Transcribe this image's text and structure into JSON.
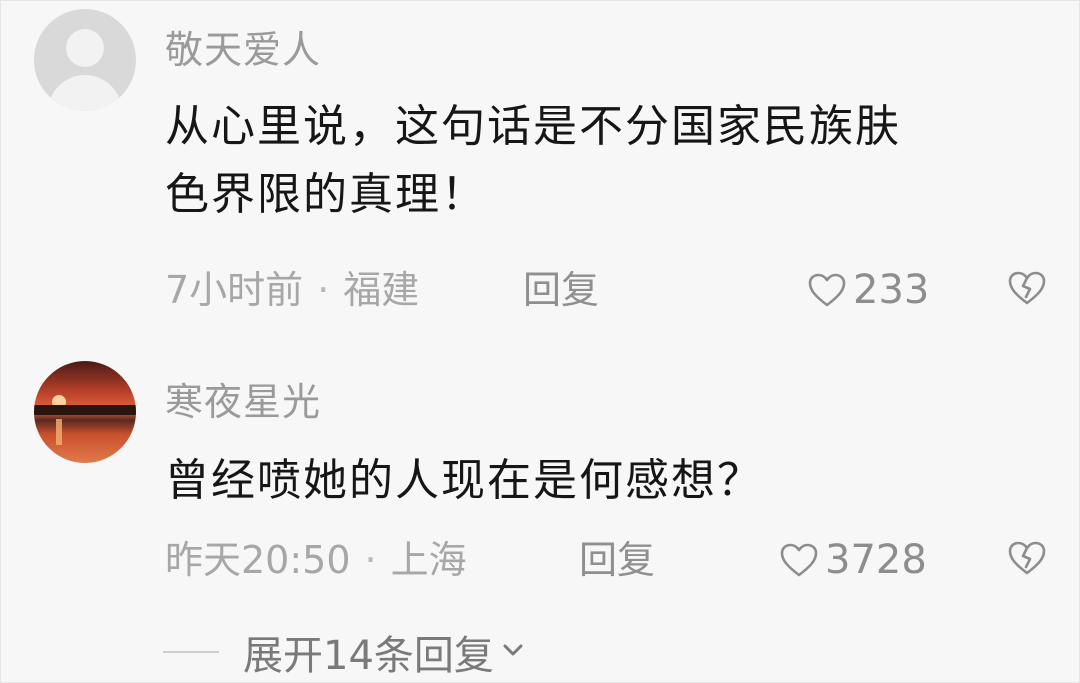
{
  "comments": [
    {
      "username": "敬天爱人",
      "avatar": "default-avatar",
      "content_lines": [
        "从心里说，这句话是不分国家民族肤",
        "色界限的真理！"
      ],
      "time": "7小时前",
      "separator": "·",
      "location": "福建",
      "reply_label": "回复",
      "likes": "233",
      "like_icon": "heart-outline-icon",
      "dislike_icon": "broken-heart-icon"
    },
    {
      "username": "寒夜星光",
      "avatar": "sunset-photo-avatar",
      "content_lines": [
        "曾经喷她的人现在是何感想？"
      ],
      "time": "昨天20:50",
      "separator": "·",
      "location": "上海",
      "reply_label": "回复",
      "likes": "3728",
      "like_icon": "heart-outline-icon",
      "dislike_icon": "broken-heart-icon"
    }
  ],
  "expand_replies": {
    "label": "展开14条回复",
    "icon": "chevron-down-icon"
  },
  "colors": {
    "background": "#f7f7f7",
    "username": "#9a9a9a",
    "content": "#161616",
    "meta": "#a7a7a7",
    "like_count": "#8d8d8d"
  }
}
